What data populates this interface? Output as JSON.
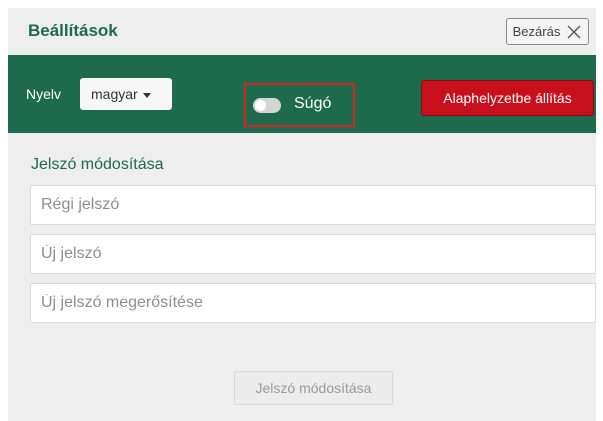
{
  "header": {
    "title": "Beállítások",
    "close_label": "Bezárás",
    "close_icon": "close-icon"
  },
  "toolbar": {
    "language_label": "Nyelv",
    "language_value": "magyar",
    "help_label": "Súgó",
    "help_toggle_on": false,
    "reset_label": "Alaphelyzetbe állítás"
  },
  "password": {
    "section_title": "Jelszó módosítása",
    "old_placeholder": "Régi jelszó",
    "new_placeholder": "Új jelszó",
    "confirm_placeholder": "Új jelszó megerősítése",
    "submit_label": "Jelszó módosítása"
  },
  "colors": {
    "brand_green": "#1e6a4d",
    "reset_red": "#c8101d",
    "highlight_red": "#d92323"
  }
}
